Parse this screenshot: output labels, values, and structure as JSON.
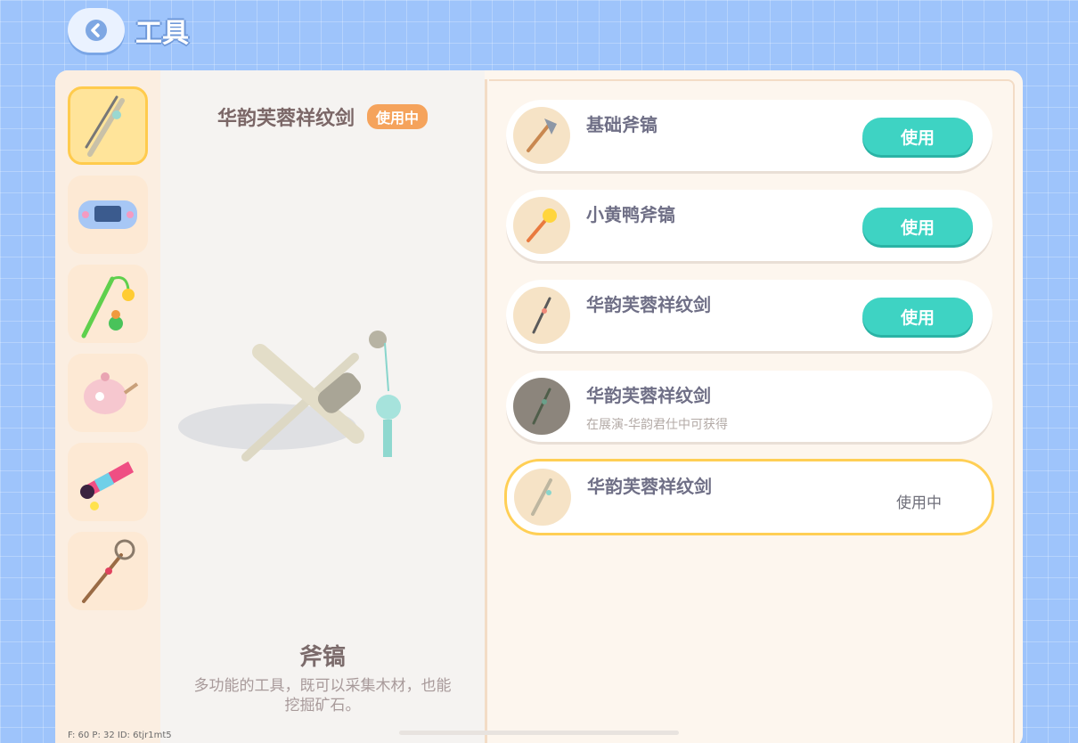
{
  "header": {
    "title": "工具",
    "back_icon": "chevron-left-icon"
  },
  "sidebar": {
    "categories": [
      {
        "icon": "sword-tool-icon",
        "active": true
      },
      {
        "icon": "game-console-icon",
        "active": false
      },
      {
        "icon": "fishing-rod-icon",
        "active": false
      },
      {
        "icon": "teapot-icon",
        "active": false
      },
      {
        "icon": "telescope-icon",
        "active": false
      },
      {
        "icon": "bug-net-icon",
        "active": false
      }
    ]
  },
  "detail": {
    "name": "华韵芙蓉祥纹剑",
    "badge": "使用中",
    "type": "斧镐",
    "description": "多功能的工具，既可以采集木材，也能挖掘矿石。"
  },
  "items": [
    {
      "name": "基础斧镐",
      "subtitle": "",
      "action": "使用",
      "icon": "axe-icon"
    },
    {
      "name": "小黄鸭斧镐",
      "subtitle": "",
      "action": "使用",
      "icon": "duck-axe-icon"
    },
    {
      "name": "华韵芙蓉祥纹剑",
      "subtitle": "",
      "action": "使用",
      "icon": "sword-icon"
    },
    {
      "name": "华韵芙蓉祥纹剑",
      "subtitle": "在展演-华韵君仕中可获得",
      "action": "",
      "icon": "sword-icon"
    },
    {
      "name": "华韵芙蓉祥纹剑",
      "subtitle": "",
      "status": "使用中",
      "icon": "sword-icon"
    }
  ],
  "debug": "F: 60    P: 32    ID: 6tjr1mt5",
  "colors": {
    "accent": "#3ed3c3",
    "badge": "#f5a35c",
    "selected_border": "#ffcf55"
  }
}
